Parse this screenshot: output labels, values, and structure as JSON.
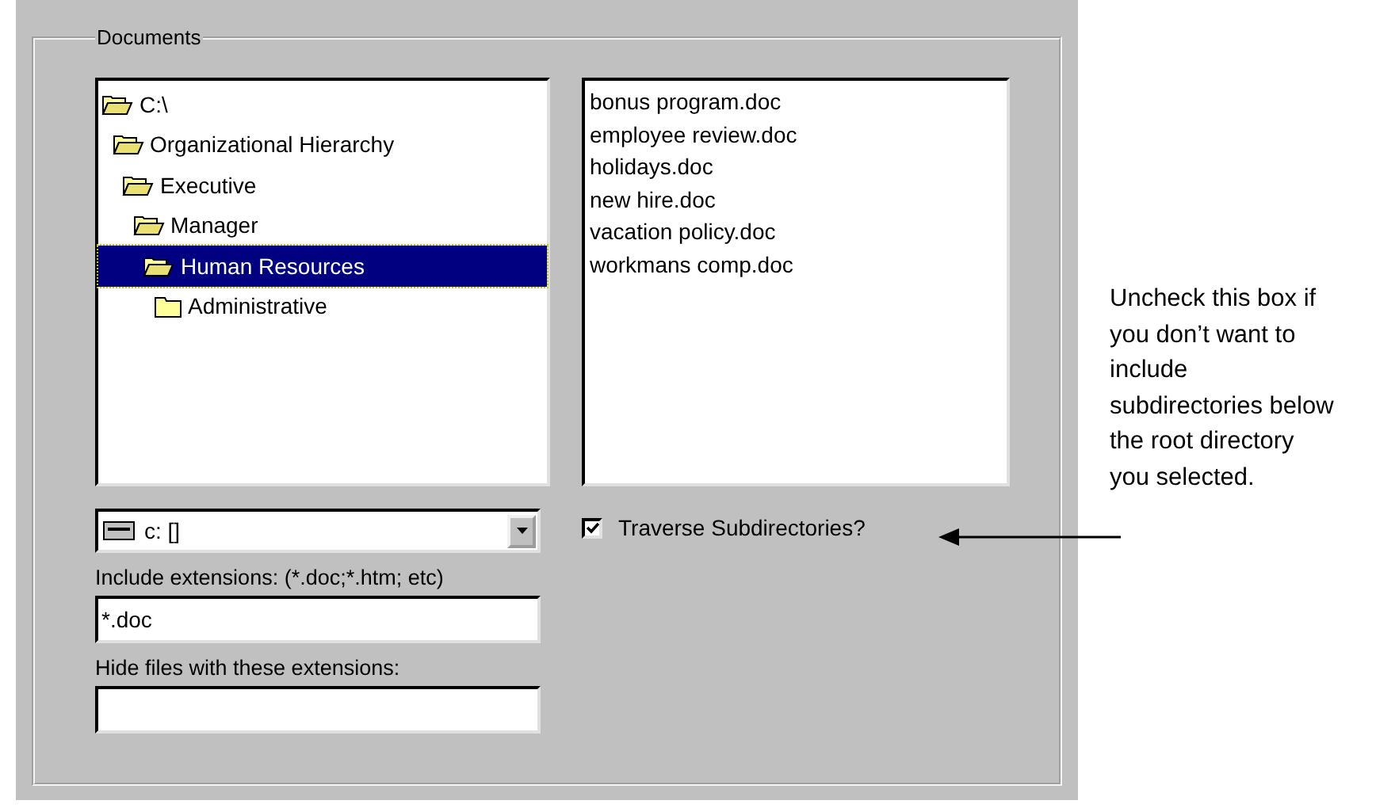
{
  "group": {
    "title": "Documents"
  },
  "tree": [
    {
      "name": "C:\\",
      "open": true,
      "selected": false,
      "children": [
        {
          "name": "Organizational Hierarchy",
          "open": true,
          "selected": false,
          "children": [
            {
              "name": "Executive",
              "open": true,
              "selected": false,
              "children": [
                {
                  "name": "Manager",
                  "open": true,
                  "selected": false,
                  "children": [
                    {
                      "name": "Human Resources",
                      "open": true,
                      "selected": true,
                      "children": [
                        {
                          "name": "Administrative",
                          "open": false,
                          "selected": false
                        }
                      ]
                    }
                  ]
                }
              ]
            }
          ]
        }
      ]
    }
  ],
  "files": [
    "bonus program.doc",
    "employee review.doc",
    "holidays.doc",
    "new hire.doc",
    "vacation policy.doc",
    "workmans comp.doc"
  ],
  "drive": {
    "value": "c: []"
  },
  "include": {
    "label": "Include extensions: (*.doc;*.htm; etc)",
    "value": "*.doc"
  },
  "hide": {
    "label": "Hide files with these extensions:"
  },
  "traverse": {
    "label": "Traverse Subdirectories?",
    "checked": true
  },
  "callout": "Uncheck this box if you don’t want to include subdirectories below the root directory you selected."
}
